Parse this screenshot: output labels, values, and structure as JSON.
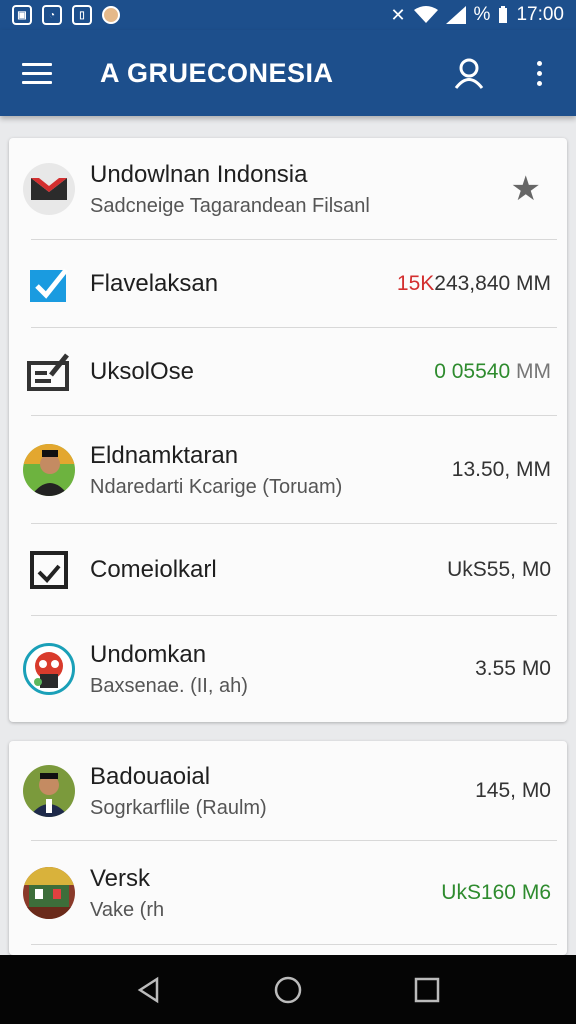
{
  "status_bar": {
    "battery_label": "%",
    "time": "17:00",
    "icons": [
      "notification-icon",
      "message-icon",
      "sim-icon",
      "face-icon",
      "mute-icon",
      "wifi-icon",
      "signal-icon"
    ]
  },
  "app_bar": {
    "title": "A GRUECONESIA",
    "icons": [
      "menu-icon",
      "person-icon",
      "more-vertical-icon"
    ],
    "color": "#1d4f8c"
  },
  "card1": {
    "header": {
      "title": "Undowlnan Indonsia",
      "subtitle": "Sadcneige Tagarandean Filsanl",
      "icon": "star-icon"
    },
    "rows": [
      {
        "title": "Flavelaksan",
        "value_prefix": "15K",
        "value": "243,840 MM",
        "icon": "checkbox-icon"
      },
      {
        "title": "UksolOse",
        "value": "0 05540",
        "value_suffix": "MM",
        "icon": "document-edit-icon"
      },
      {
        "title": "Eldnamktaran",
        "subtitle": "Ndaredarti Kcarige (Toruam)",
        "value": "13.50, MM",
        "icon": "avatar"
      },
      {
        "title": "Comeiolkarl",
        "value": "UkS55, M0",
        "icon": "check-square-icon"
      },
      {
        "title": "Undomkan",
        "subtitle": "Baxsenae. (II, ah)",
        "value": "3.55 M0",
        "icon": "avatar"
      }
    ]
  },
  "card2": {
    "rows": [
      {
        "title": "Badouaoial",
        "subtitle": "Sogrkarflile (Raulm)",
        "value": "145, M0",
        "icon": "avatar"
      },
      {
        "title": "Versk",
        "subtitle": "Vake (rh",
        "value": "UkS160 M6",
        "icon": "avatar"
      }
    ]
  },
  "colors": {
    "red_value": "#d32f2f",
    "green_value": "#2e8b2e",
    "accent_blue": "#1d4f8c"
  }
}
